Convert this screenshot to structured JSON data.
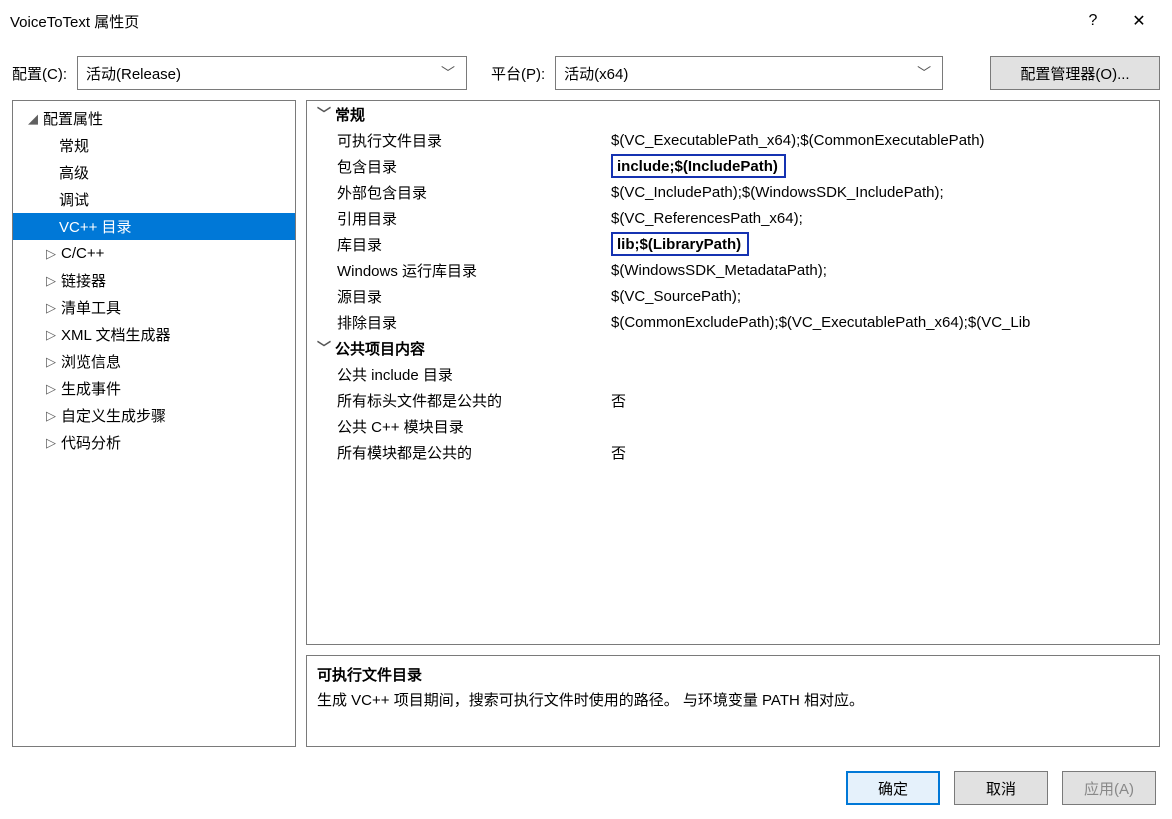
{
  "window": {
    "title": "VoiceToText 属性页",
    "help": "?",
    "close": "✕"
  },
  "configbar": {
    "config_label": "配置(C):",
    "config_value": "活动(Release)",
    "platform_label": "平台(P):",
    "platform_value": "活动(x64)",
    "cfgmgr_button": "配置管理器(O)..."
  },
  "tree": {
    "root": "配置属性",
    "items": [
      {
        "label": "常规",
        "exp": ""
      },
      {
        "label": "高级",
        "exp": ""
      },
      {
        "label": "调试",
        "exp": ""
      },
      {
        "label": "VC++ 目录",
        "exp": "",
        "selected": true
      },
      {
        "label": "C/C++",
        "exp": "▷"
      },
      {
        "label": "链接器",
        "exp": "▷"
      },
      {
        "label": "清单工具",
        "exp": "▷"
      },
      {
        "label": "XML 文档生成器",
        "exp": "▷"
      },
      {
        "label": "浏览信息",
        "exp": "▷"
      },
      {
        "label": "生成事件",
        "exp": "▷"
      },
      {
        "label": "自定义生成步骤",
        "exp": "▷"
      },
      {
        "label": "代码分析",
        "exp": "▷"
      }
    ]
  },
  "props": {
    "group1": "常规",
    "group2": "公共项目内容",
    "rows1": [
      {
        "key": "可执行文件目录",
        "val": "$(VC_ExecutablePath_x64);$(CommonExecutablePath)"
      },
      {
        "key": "包含目录",
        "val": "include;$(IncludePath)",
        "hl": true
      },
      {
        "key": "外部包含目录",
        "val": "$(VC_IncludePath);$(WindowsSDK_IncludePath);"
      },
      {
        "key": "引用目录",
        "val": "$(VC_ReferencesPath_x64);"
      },
      {
        "key": "库目录",
        "val": "lib;$(LibraryPath)",
        "hl": true
      },
      {
        "key": "Windows 运行库目录",
        "val": "$(WindowsSDK_MetadataPath);"
      },
      {
        "key": "源目录",
        "val": "$(VC_SourcePath);"
      },
      {
        "key": "排除目录",
        "val": "$(CommonExcludePath);$(VC_ExecutablePath_x64);$(VC_Lib"
      }
    ],
    "rows2": [
      {
        "key": "公共 include 目录",
        "val": ""
      },
      {
        "key": "所有标头文件都是公共的",
        "val": "否"
      },
      {
        "key": "公共 C++ 模块目录",
        "val": ""
      },
      {
        "key": "所有模块都是公共的",
        "val": "否"
      }
    ]
  },
  "desc": {
    "title": "可执行文件目录",
    "body": "生成 VC++ 项目期间，搜索可执行文件时使用的路径。 与环境变量 PATH 相对应。"
  },
  "footer": {
    "ok": "确定",
    "cancel": "取消",
    "apply": "应用(A)"
  }
}
